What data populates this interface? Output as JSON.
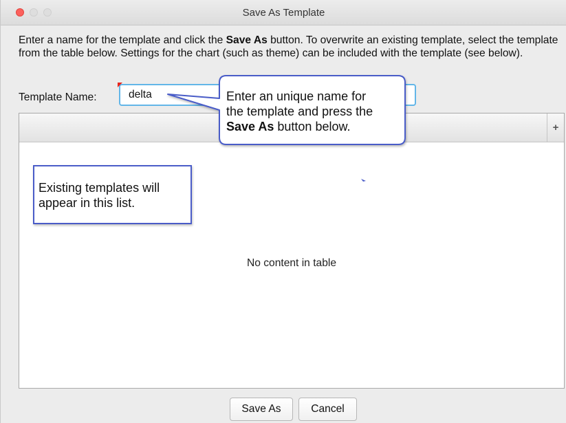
{
  "window": {
    "title": "Save As Template"
  },
  "instructions": {
    "part1": "Enter a name for the template and click the ",
    "bold": "Save As",
    "part2": " button.  To overwrite an existing template, select the template from the table below.  Settings for the chart (such as theme) can be included with the template (see below)."
  },
  "template_name": {
    "label": "Template Name:",
    "value": "delta"
  },
  "table": {
    "add_column_icon": "+",
    "empty_message": "No content in table"
  },
  "buttons": {
    "save_as": "Save As",
    "cancel": "Cancel"
  },
  "callout_name": {
    "line1": "Enter an unique name for",
    "line2": "the template and press the",
    "bold": "Save As",
    "line3_rest": " button below."
  },
  "note_list": {
    "line1": "Existing templates will",
    "line2": "appear in this list."
  },
  "colors": {
    "close_button": "#fc615d",
    "focus_ring": "#62b6e8",
    "callout_border": "#4a5cc8",
    "window_bg": "#ececec"
  }
}
